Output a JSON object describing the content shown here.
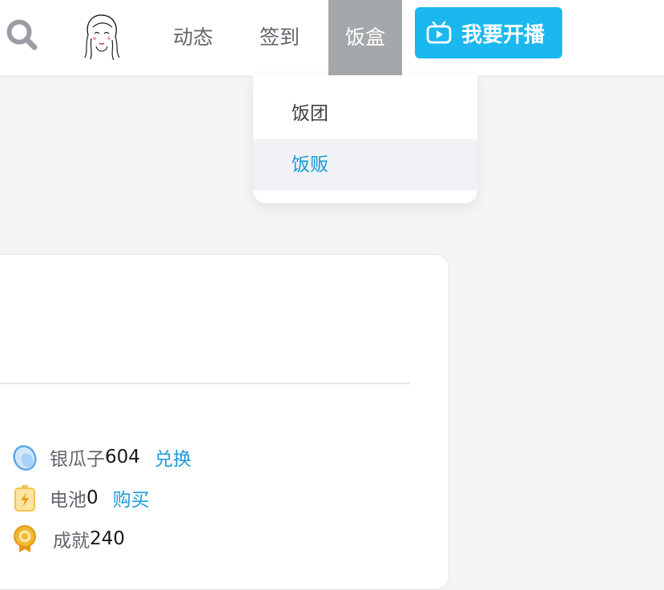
{
  "header": {
    "nav": [
      "动态",
      "签到",
      "饭盒"
    ],
    "live_button": "我要开播"
  },
  "dropdown": {
    "items": [
      "饭团",
      "饭贩"
    ]
  },
  "stats": {
    "silver": {
      "label": "银瓜子",
      "value": "604",
      "action": "兑换"
    },
    "battery": {
      "label": "电池",
      "value": "0",
      "action": "购买"
    },
    "achievement": {
      "label": "成就",
      "value": "240"
    }
  },
  "colors": {
    "accent": "#1a9cd8",
    "live_button": "#1ab8ee",
    "active_nav_bg": "#a5a8ab"
  }
}
